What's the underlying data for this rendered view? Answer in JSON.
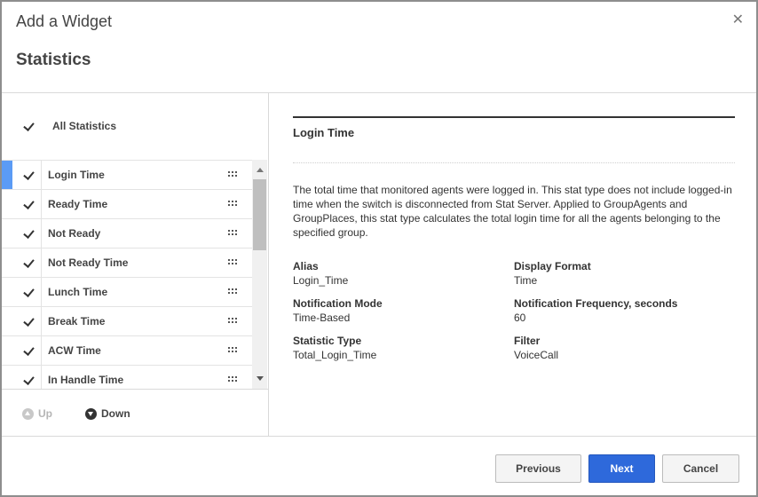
{
  "dialog": {
    "title": "Add a Widget",
    "subtitle": "Statistics",
    "close_icon": "close-icon"
  },
  "all_statistics": {
    "label": "All Statistics",
    "checked": true
  },
  "statistics": [
    {
      "label": "Login Time",
      "checked": true,
      "selected": true
    },
    {
      "label": "Ready Time",
      "checked": true
    },
    {
      "label": "Not Ready",
      "checked": true
    },
    {
      "label": "Not Ready Time",
      "checked": true
    },
    {
      "label": "Lunch Time",
      "checked": true
    },
    {
      "label": "Break Time",
      "checked": true
    },
    {
      "label": "ACW Time",
      "checked": true
    },
    {
      "label": "In Handle Time",
      "checked": true
    }
  ],
  "move": {
    "up_label": "Up",
    "down_label": "Down"
  },
  "detail": {
    "title": "Login Time",
    "description": "The total time that monitored agents were logged in. This stat type does not include logged-in time when the switch is disconnected from Stat Server. Applied to GroupAgents and GroupPlaces, this stat type calculates the total login time for all the agents belonging to the specified group.",
    "props": {
      "alias": {
        "key": "Alias",
        "value": "Login_Time"
      },
      "display_format": {
        "key": "Display Format",
        "value": "Time"
      },
      "notification_mode": {
        "key": "Notification Mode",
        "value": "Time-Based"
      },
      "notification_frequency": {
        "key": "Notification Frequency, seconds",
        "value": "60"
      },
      "statistic_type": {
        "key": "Statistic Type",
        "value": "Total_Login_Time"
      },
      "filter": {
        "key": "Filter",
        "value": "VoiceCall"
      }
    }
  },
  "footer": {
    "previous_label": "Previous",
    "next_label": "Next",
    "cancel_label": "Cancel"
  },
  "colors": {
    "accent": "#2e69db",
    "selected_marker": "#5b9bf5"
  }
}
